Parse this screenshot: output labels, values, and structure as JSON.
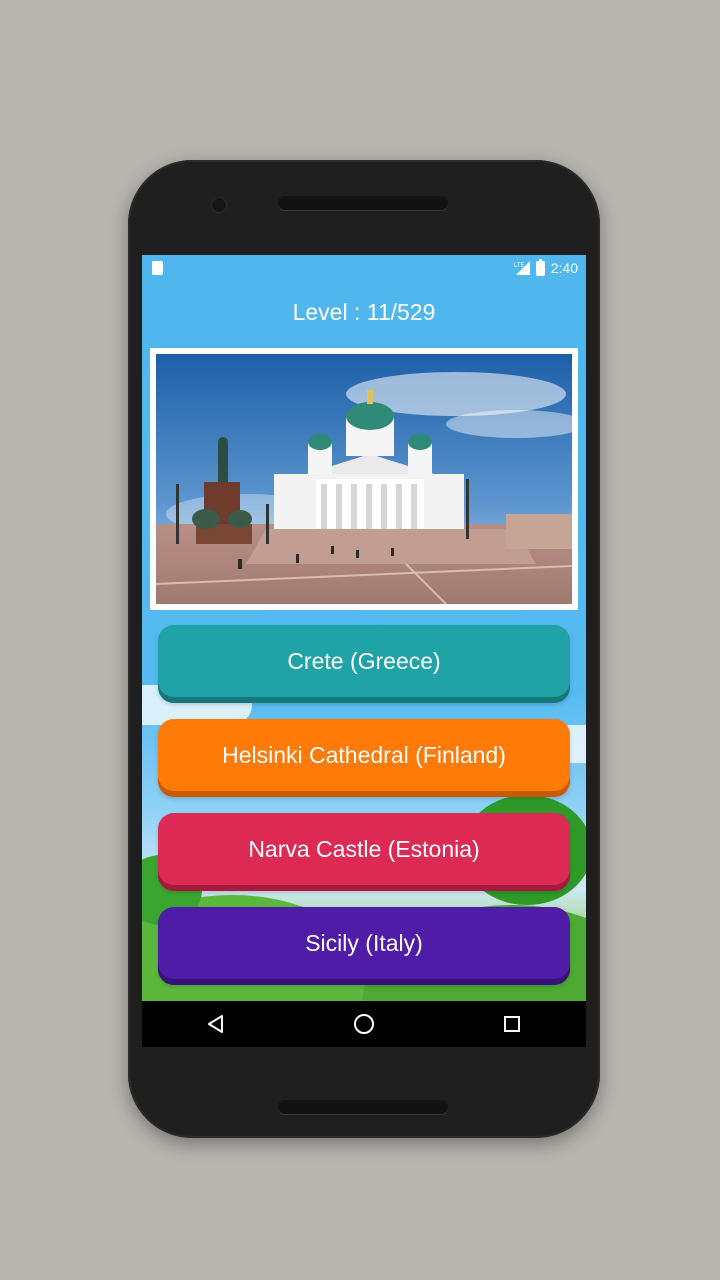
{
  "status_bar": {
    "time": "2:40",
    "network": "LTE"
  },
  "game": {
    "level_text": "Level : 11/529",
    "photo_subject": "helsinki-cathedral-photo"
  },
  "answers": [
    {
      "label": "Crete (Greece)",
      "color": "#1fa3a6",
      "shade": "#15797b"
    },
    {
      "label": "Helsinki Cathedral (Finland)",
      "color": "#ff7a07",
      "shade": "#c95a00"
    },
    {
      "label": "Narva Castle (Estonia)",
      "color": "#dc2a55",
      "shade": "#a71a3d"
    },
    {
      "label": "Sicily (Italy)",
      "color": "#4f1ca7",
      "shade": "#36117a"
    }
  ],
  "nav": {
    "back_icon": "back-triangle-icon",
    "home_icon": "home-circle-icon",
    "recents_icon": "recents-square-icon"
  }
}
